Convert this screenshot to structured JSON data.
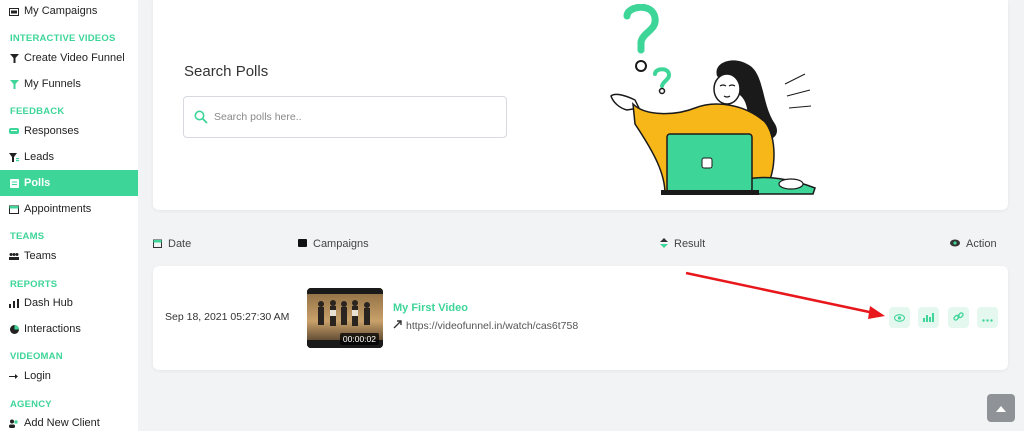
{
  "sidebar": {
    "items": [
      {
        "label": "My Campaigns",
        "icon": "camera-icon"
      },
      {
        "label": "Create Video Funnel",
        "icon": "funnel-icon"
      },
      {
        "label": "My Funnels",
        "icon": "funnel-icon"
      },
      {
        "label": "Responses",
        "icon": "chat-icon"
      },
      {
        "label": "Leads",
        "icon": "filter-icon"
      },
      {
        "label": "Polls",
        "icon": "list-icon"
      },
      {
        "label": "Appointments",
        "icon": "calendar-icon"
      },
      {
        "label": "Teams",
        "icon": "team-icon"
      },
      {
        "label": "Dash Hub",
        "icon": "bars-icon"
      },
      {
        "label": "Interactions",
        "icon": "pie-icon"
      },
      {
        "label": "Login",
        "icon": "login-icon"
      },
      {
        "label": "Add New Client",
        "icon": "users-icon"
      }
    ],
    "sections": {
      "interactive": "INTERACTIVE VIDEOS",
      "feedback": "FEEDBACK",
      "teams": "TEAMS",
      "reports": "REPORTS",
      "videoman": "VIDEOMAN",
      "agency": "AGENCY"
    }
  },
  "search": {
    "title": "Search Polls",
    "placeholder": "Search polls here.."
  },
  "table": {
    "headers": {
      "date": "Date",
      "campaigns": "Campaigns",
      "result": "Result",
      "action": "Action"
    },
    "rows": [
      {
        "date": "Sep 18, 2021 05:27:30 AM",
        "title": "My First Video",
        "link": "https://videofunnel.in/watch/cas6t758",
        "duration": "00:00:02"
      }
    ]
  },
  "colors": {
    "accent": "#3ed598",
    "action_bg": "#e4f8ef",
    "arrow": "#e8171b"
  }
}
